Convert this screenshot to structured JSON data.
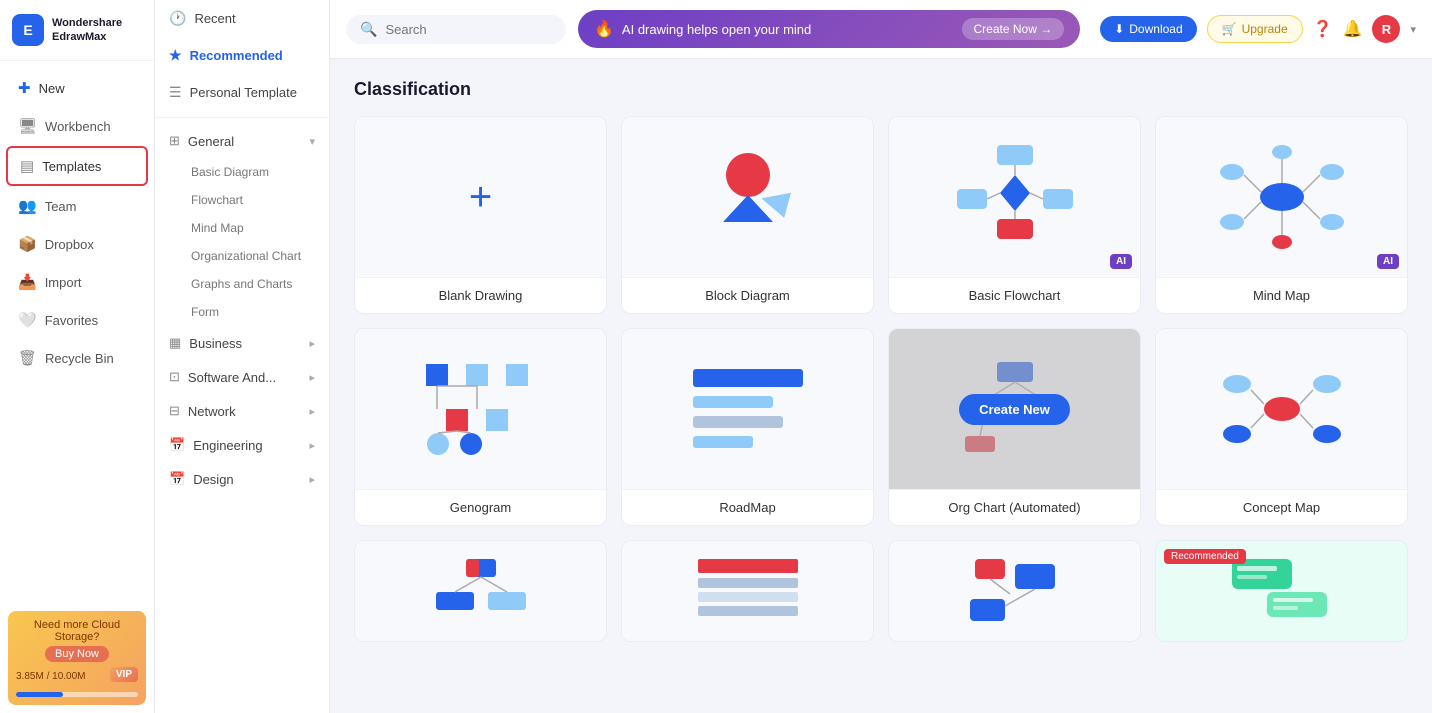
{
  "app": {
    "logo_text_line1": "Wondershare",
    "logo_text_line2": "EdrawMax"
  },
  "sidebar": {
    "items": [
      {
        "id": "new",
        "label": "New",
        "icon": "➕"
      },
      {
        "id": "workbench",
        "label": "Workbench",
        "icon": "🖥"
      },
      {
        "id": "templates",
        "label": "Templates",
        "icon": "📋"
      },
      {
        "id": "team",
        "label": "Team",
        "icon": "👥"
      },
      {
        "id": "dropbox",
        "label": "Dropbox",
        "icon": "📦"
      },
      {
        "id": "import",
        "label": "Import",
        "icon": "📥"
      },
      {
        "id": "favorites",
        "label": "Favorites",
        "icon": "🤍"
      },
      {
        "id": "recycle",
        "label": "Recycle Bin",
        "icon": "🗑"
      }
    ],
    "storage": {
      "cta": "Need more Cloud Storage?",
      "buy_label": "Buy Now",
      "used": "3.85M",
      "total": "10.00M",
      "vip_label": "VIP"
    }
  },
  "middle_panel": {
    "items": [
      {
        "id": "recent",
        "label": "Recent",
        "icon": "🕐"
      },
      {
        "id": "recommended",
        "label": "Recommended",
        "icon": "★",
        "active": true
      },
      {
        "id": "personal_template",
        "label": "Personal Template",
        "icon": "☰"
      }
    ],
    "categories": [
      {
        "id": "general",
        "label": "General",
        "expanded": true,
        "subs": [
          "Basic Diagram",
          "Flowchart",
          "Mind Map",
          "Organizational Chart",
          "Graphs and Charts",
          "Form"
        ]
      },
      {
        "id": "business",
        "label": "Business",
        "expanded": false,
        "subs": []
      },
      {
        "id": "software",
        "label": "Software And...",
        "expanded": false,
        "subs": []
      },
      {
        "id": "network",
        "label": "Network",
        "expanded": false,
        "subs": []
      },
      {
        "id": "engineering",
        "label": "Engineering",
        "expanded": false,
        "subs": []
      },
      {
        "id": "design",
        "label": "Design",
        "expanded": false,
        "subs": []
      }
    ]
  },
  "topbar": {
    "search_placeholder": "Search",
    "ai_banner_text": "AI drawing helps open your mind",
    "ai_create_label": "Create Now →",
    "download_label": "Download",
    "upgrade_label": "Upgrade",
    "avatar_letter": "R"
  },
  "main": {
    "section_title": "Classification",
    "cards": [
      {
        "id": "blank",
        "label": "Blank Drawing",
        "type": "blank",
        "ai": false,
        "recommended": false,
        "overlay": false
      },
      {
        "id": "block",
        "label": "Block Diagram",
        "type": "block",
        "ai": false,
        "recommended": false,
        "overlay": false
      },
      {
        "id": "flowchart",
        "label": "Basic Flowchart",
        "type": "flowchart",
        "ai": true,
        "recommended": false,
        "overlay": false
      },
      {
        "id": "mindmap",
        "label": "Mind Map",
        "type": "mindmap",
        "ai": true,
        "recommended": false,
        "overlay": false
      },
      {
        "id": "genogram",
        "label": "Genogram",
        "type": "genogram",
        "ai": false,
        "recommended": false,
        "overlay": false
      },
      {
        "id": "roadmap",
        "label": "RoadMap",
        "type": "roadmap",
        "ai": false,
        "recommended": false,
        "overlay": false
      },
      {
        "id": "orgchart",
        "label": "Org Chart (Automated)",
        "type": "orgchart",
        "ai": false,
        "recommended": false,
        "overlay": true
      },
      {
        "id": "conceptmap",
        "label": "Concept Map",
        "type": "conceptmap",
        "ai": false,
        "recommended": false,
        "overlay": false
      }
    ],
    "bottom_cards": [
      {
        "id": "b1",
        "label": "",
        "type": "tree1",
        "recommended": false
      },
      {
        "id": "b2",
        "label": "",
        "type": "table1",
        "recommended": false
      },
      {
        "id": "b3",
        "label": "",
        "type": "folder1",
        "recommended": false
      },
      {
        "id": "b4",
        "label": "",
        "type": "chat1",
        "recommended": true
      }
    ],
    "create_new_label": "Create New",
    "ai_label": "AI",
    "recommended_label": "Recommended"
  }
}
